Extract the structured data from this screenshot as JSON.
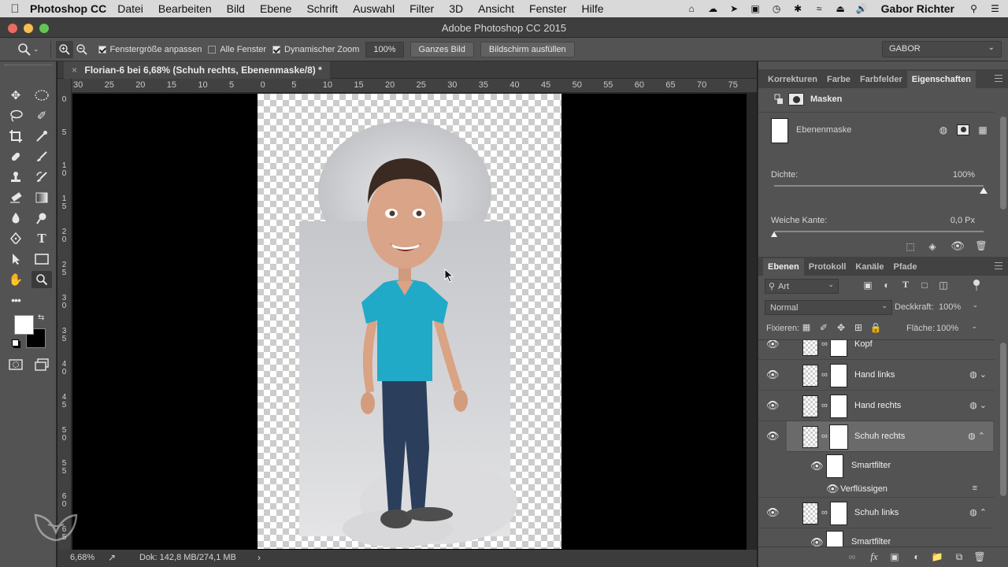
{
  "menubar": {
    "app_name": "Photoshop CC",
    "items": [
      "Datei",
      "Bearbeiten",
      "Bild",
      "Ebene",
      "Schrift",
      "Auswahl",
      "Filter",
      "3D",
      "Ansicht",
      "Fenster",
      "Hilfe"
    ],
    "user": "Gabor Richter"
  },
  "window": {
    "title": "Adobe Photoshop CC 2015"
  },
  "options": {
    "fit_window_label": "Fenstergröße anpassen",
    "all_windows_label": "Alle Fenster",
    "dynamic_zoom_label": "Dynamischer Zoom",
    "zoom_value": "100%",
    "fit_screen_button": "Ganzes Bild",
    "fill_screen_button": "Bildschirm ausfüllen",
    "workspace": "GABOR"
  },
  "document": {
    "tab_title": "Florian-6 bei 6,68% (Schuh rechts, Ebenenmaske/8) *",
    "ruler_h": [
      "30",
      "25",
      "20",
      "15",
      "10",
      "5",
      "0",
      "5",
      "10",
      "15",
      "20",
      "25",
      "30",
      "35",
      "40",
      "45",
      "50",
      "55",
      "60",
      "65",
      "70",
      "75"
    ],
    "ruler_v": [
      "0",
      "5",
      "10",
      "15",
      "20",
      "25",
      "30",
      "35",
      "40",
      "45",
      "50",
      "55",
      "60",
      "65"
    ],
    "zoom": "6,68%",
    "doc_size": "Dok: 142,8 MB/274,1 MB"
  },
  "properties_panel": {
    "tabs": [
      "Korrekturen",
      "Farbe",
      "Farbfelder",
      "Eigenschaften"
    ],
    "active_tab": "Eigenschaften",
    "section": "Masken",
    "mask_label": "Ebenenmaske",
    "density_label": "Dichte:",
    "density_value": "100%",
    "density_level": 1.0,
    "feather_label": "Weiche Kante:",
    "feather_value": "0,0 Px",
    "feather_level": 0.0
  },
  "layers_panel": {
    "tabs": [
      "Ebenen",
      "Protokoll",
      "Kanäle",
      "Pfade"
    ],
    "active_tab": "Ebenen",
    "filter_kind": "Art",
    "blend_mode": "Normal",
    "opacity_label": "Deckkraft:",
    "opacity_value": "100%",
    "lock_label": "Fixieren:",
    "fill_label": "Fläche:",
    "fill_value": "100%",
    "layers": [
      {
        "name": "Kopf"
      },
      {
        "name": "Hand links"
      },
      {
        "name": "Hand rechts"
      },
      {
        "name": "Schuh rechts",
        "selected": true
      },
      {
        "name": "Smartfilter",
        "sub": true
      },
      {
        "name": "Verflüssigen",
        "filter": true
      },
      {
        "name": "Schuh links"
      },
      {
        "name": "Smartfilter",
        "sub": true
      }
    ]
  }
}
